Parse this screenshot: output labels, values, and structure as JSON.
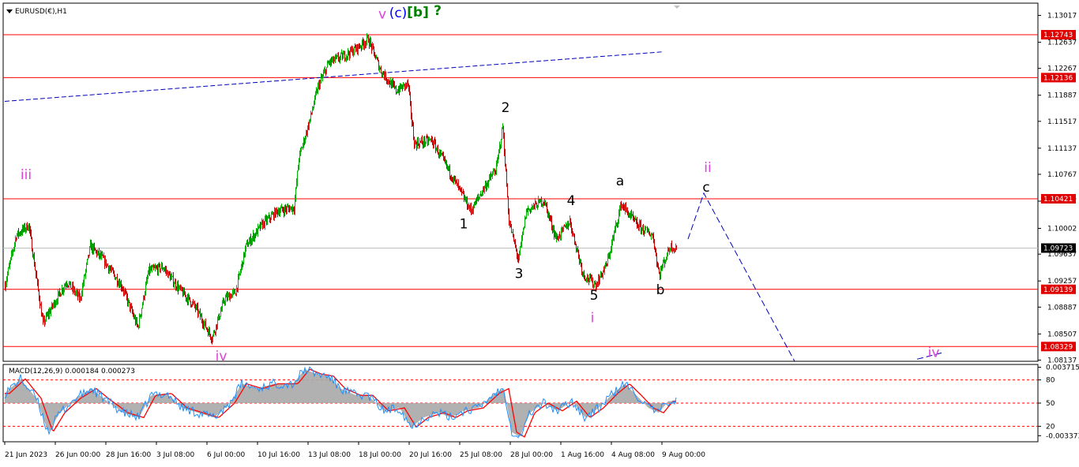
{
  "window": {
    "title": "EURUSD(€),H1",
    "menu_icon": "triangle-down-icon"
  },
  "colors": {
    "background": "#ffffff",
    "frame": "#000000",
    "bull_candle": "#00b400",
    "bear_candle": "#c80000",
    "level_line": "#ff0000",
    "level_label_bg": "#e00000",
    "current_price_bg": "#000000",
    "current_price_line": "#c0c0c0",
    "projection_line": "#0000bb",
    "wave_magenta": "#e040e0",
    "wave_blue": "#0000ff",
    "wave_green": "#008000",
    "wave_black": "#000000",
    "macd_histogram": "#a8a8a8",
    "macd_signal": "#ff0000",
    "macd_line": "#1e90ff"
  },
  "chart_data": [
    {
      "type": "candlestick",
      "title": "EURUSD(€),H1",
      "symbol": "EURUSD",
      "timeframe": "H1",
      "ylim": [
        1.0812,
        1.1319
      ],
      "y_ticks": [
        "1.13017",
        "1.12637",
        "1.12267",
        "1.11887",
        "1.11517",
        "1.11137",
        "1.10767",
        "1.10387",
        "1.10002",
        "1.09637",
        "1.09257",
        "1.08887",
        "1.08507",
        "1.08137"
      ],
      "y_tick_values": [
        1.13017,
        1.12637,
        1.12267,
        1.11887,
        1.11517,
        1.11137,
        1.10767,
        1.10387,
        1.10002,
        1.09637,
        1.09257,
        1.08887,
        1.08507,
        1.08137
      ],
      "x_ticks": [
        "21 Jun 2023",
        "26 Jun 00:00",
        "28 Jun 16:00",
        "3 Jul 08:00",
        "6 Jul 00:00",
        "10 Jul 16:00",
        "13 Jul 08:00",
        "18 Jul 00:00",
        "20 Jul 16:00",
        "25 Jul 08:00",
        "28 Jul 00:00",
        "1 Aug 16:00",
        "4 Aug 08:00",
        "9 Aug 00:00"
      ],
      "x_tick_bars": [
        0,
        64,
        128,
        192,
        256,
        320,
        384,
        448,
        512,
        576,
        640,
        704,
        768,
        832
      ],
      "horizontal_levels": [
        "1.12743",
        "1.12136",
        "1.10421",
        "1.09139",
        "1.08329"
      ],
      "horizontal_level_values": [
        1.12743,
        1.12136,
        1.10421,
        1.09139,
        1.08329
      ],
      "current_price": "1.09723",
      "current_price_value": 1.09723,
      "bars_per_pixel": 1,
      "last_bar_index": 850,
      "path_points": [
        [
          0,
          1.092
        ],
        [
          14,
          1.099
        ],
        [
          30,
          1.1005
        ],
        [
          48,
          1.0865
        ],
        [
          60,
          1.089
        ],
        [
          78,
          1.0925
        ],
        [
          95,
          1.09
        ],
        [
          108,
          1.0975
        ],
        [
          125,
          1.0955
        ],
        [
          148,
          1.0918
        ],
        [
          168,
          1.086
        ],
        [
          182,
          1.094
        ],
        [
          200,
          1.0945
        ],
        [
          220,
          1.0915
        ],
        [
          240,
          1.089
        ],
        [
          262,
          1.0845
        ],
        [
          278,
          1.09
        ],
        [
          292,
          1.091
        ],
        [
          305,
          1.0975
        ],
        [
          325,
          1.1005
        ],
        [
          345,
          1.1025
        ],
        [
          366,
          1.103
        ],
        [
          372,
          1.11
        ],
        [
          385,
          1.115
        ],
        [
          396,
          1.12
        ],
        [
          410,
          1.1235
        ],
        [
          430,
          1.1245
        ],
        [
          445,
          1.1255
        ],
        [
          460,
          1.1268
        ],
        [
          475,
          1.1225
        ],
        [
          495,
          1.1195
        ],
        [
          510,
          1.1205
        ],
        [
          518,
          1.112
        ],
        [
          540,
          1.1125
        ],
        [
          558,
          1.109
        ],
        [
          575,
          1.1055
        ],
        [
          590,
          1.1025
        ],
        [
          605,
          1.1055
        ],
        [
          622,
          1.1085
        ],
        [
          630,
          1.1145
        ],
        [
          638,
          1.101
        ],
        [
          650,
          1.0955
        ],
        [
          660,
          1.1025
        ],
        [
          682,
          1.104
        ],
        [
          698,
          1.0985
        ],
        [
          715,
          1.101
        ],
        [
          732,
          1.0935
        ],
        [
          748,
          1.092
        ],
        [
          762,
          1.095
        ],
        [
          780,
          1.1035
        ],
        [
          800,
          1.1005
        ],
        [
          820,
          1.099
        ],
        [
          828,
          1.0935
        ],
        [
          842,
          1.0975
        ],
        [
          850,
          1.0972
        ]
      ],
      "projection": {
        "points": [
          [
            865,
            1.0985
          ],
          [
            885,
            1.105
          ],
          [
            1000,
            1.0812
          ]
        ],
        "tail": [
          [
            1155,
            1.0815
          ],
          [
            1190,
            1.0825
          ]
        ]
      },
      "trendline": {
        "points": [
          [
            0,
            1.118
          ],
          [
            832,
            1.125
          ]
        ]
      },
      "wave_labels": [
        {
          "text": "v",
          "color": "wave_magenta",
          "bar": 478,
          "price": 1.1297
        },
        {
          "text": "(c)",
          "color": "wave_blue",
          "bar": 498,
          "price": 1.1299
        },
        {
          "text": "[b]",
          "color": "wave_green",
          "bar": 523,
          "price": 1.13
        },
        {
          "text": "?",
          "color": "wave_green",
          "bar": 548,
          "price": 1.1302
        },
        {
          "text": "iii",
          "color": "wave_magenta",
          "bar": 27,
          "price": 1.107
        },
        {
          "text": "iv",
          "color": "wave_magenta",
          "bar": 274,
          "price": 1.0813
        },
        {
          "text": "2",
          "color": "wave_black",
          "bar": 634,
          "price": 1.1165
        },
        {
          "text": "1",
          "color": "wave_black",
          "bar": 581,
          "price": 1.1
        },
        {
          "text": "3",
          "color": "wave_black",
          "bar": 651,
          "price": 1.093
        },
        {
          "text": "4",
          "color": "wave_black",
          "bar": 717,
          "price": 1.1033
        },
        {
          "text": "a",
          "color": "wave_black",
          "bar": 779,
          "price": 1.1061
        },
        {
          "text": "5",
          "color": "wave_black",
          "bar": 746,
          "price": 1.0899
        },
        {
          "text": "i",
          "color": "wave_magenta",
          "bar": 744,
          "price": 1.0867
        },
        {
          "text": "b",
          "color": "wave_black",
          "bar": 830,
          "price": 1.0907
        },
        {
          "text": "ii",
          "color": "wave_magenta",
          "bar": 890,
          "price": 1.108
        },
        {
          "text": "c",
          "color": "wave_black",
          "bar": 888,
          "price": 1.1052
        },
        {
          "text": "iv",
          "color": "wave_magenta",
          "bar": 1176,
          "price": 1.0818
        }
      ]
    },
    {
      "type": "macd",
      "title": "MACD(12,26,9) 0.000184 0.000273",
      "params": "12,26,9",
      "macd_value": 0.000184,
      "signal_value": 0.000273,
      "ylim": [
        -0.004,
        0.004
      ],
      "y_ticks": [
        "0.003715",
        "80",
        "50",
        "20",
        "-0.003373"
      ],
      "y_tick_values": [
        0.003715,
        0.0024,
        0.0,
        -0.0024,
        -0.003373
      ],
      "reference_levels": [
        0.0024,
        0.0,
        -0.0024
      ],
      "series": [
        {
          "name": "histogram",
          "color": "macd_histogram"
        },
        {
          "name": "signal",
          "color": "macd_signal"
        },
        {
          "name": "macd",
          "color": "macd_line"
        }
      ],
      "histogram_points": [
        [
          0,
          0.001
        ],
        [
          20,
          0.0025
        ],
        [
          40,
          0.0005
        ],
        [
          55,
          -0.003
        ],
        [
          70,
          -0.001
        ],
        [
          90,
          0.0005
        ],
        [
          110,
          0.0015
        ],
        [
          125,
          0.0005
        ],
        [
          150,
          -0.001
        ],
        [
          170,
          -0.0015
        ],
        [
          185,
          0.0008
        ],
        [
          205,
          0.001
        ],
        [
          225,
          -0.0005
        ],
        [
          245,
          -0.001
        ],
        [
          265,
          -0.0015
        ],
        [
          285,
          0.0
        ],
        [
          300,
          0.002
        ],
        [
          320,
          0.0015
        ],
        [
          340,
          0.002
        ],
        [
          365,
          0.002
        ],
        [
          380,
          0.0035
        ],
        [
          395,
          0.003
        ],
        [
          410,
          0.0028
        ],
        [
          425,
          0.0015
        ],
        [
          445,
          0.0008
        ],
        [
          460,
          0.0008
        ],
        [
          480,
          -0.0008
        ],
        [
          500,
          -0.0005
        ],
        [
          515,
          -0.0025
        ],
        [
          530,
          -0.0015
        ],
        [
          550,
          -0.001
        ],
        [
          565,
          -0.0015
        ],
        [
          580,
          -0.0008
        ],
        [
          600,
          -0.0005
        ],
        [
          620,
          0.001
        ],
        [
          632,
          0.0015
        ],
        [
          642,
          -0.003
        ],
        [
          652,
          -0.0035
        ],
        [
          665,
          -0.001
        ],
        [
          682,
          0.0
        ],
        [
          700,
          -0.0008
        ],
        [
          718,
          0.0002
        ],
        [
          735,
          -0.0015
        ],
        [
          752,
          -0.0005
        ],
        [
          770,
          0.001
        ],
        [
          785,
          0.002
        ],
        [
          800,
          0.0008
        ],
        [
          815,
          -0.0005
        ],
        [
          828,
          -0.001
        ],
        [
          840,
          0.0002
        ],
        [
          850,
          0.0002
        ]
      ]
    }
  ]
}
